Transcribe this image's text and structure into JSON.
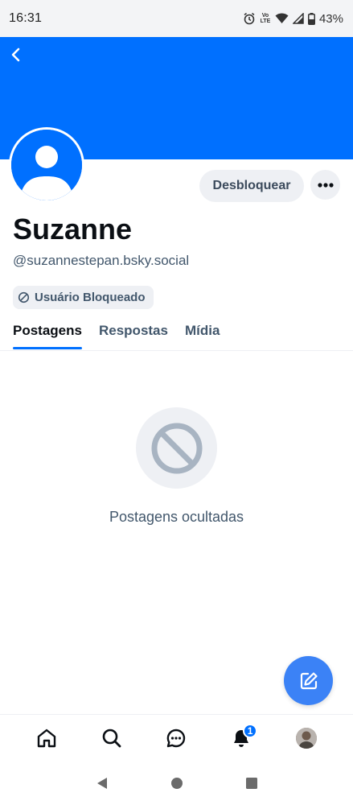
{
  "status_bar": {
    "time": "16:31",
    "network_label": "Vo LTE",
    "battery": "43%",
    "icons": [
      "alarm-icon",
      "volte-icon",
      "wifi-icon",
      "signal-icon",
      "battery-icon"
    ]
  },
  "profile": {
    "display_name": "Suzanne",
    "handle": "@suzannestepan.bsky.social",
    "unblock_label": "Desbloquear",
    "blocked_badge": "Usuário Bloqueado",
    "banner_color": "#0070ff"
  },
  "tabs": [
    {
      "label": "Postagens",
      "active": true
    },
    {
      "label": "Respostas",
      "active": false
    },
    {
      "label": "Mídia",
      "active": false
    }
  ],
  "empty_state": {
    "message": "Postagens ocultadas",
    "icon": "ban-icon"
  },
  "bottom_nav": {
    "items": [
      "home-icon",
      "search-icon",
      "chat-icon",
      "notifications-icon",
      "profile-avatar"
    ],
    "notification_count": "1"
  },
  "colors": {
    "accent": "#0070ff",
    "fab": "#3b82f6",
    "muted_text": "#42576c",
    "pill_bg": "#eef0f4"
  }
}
